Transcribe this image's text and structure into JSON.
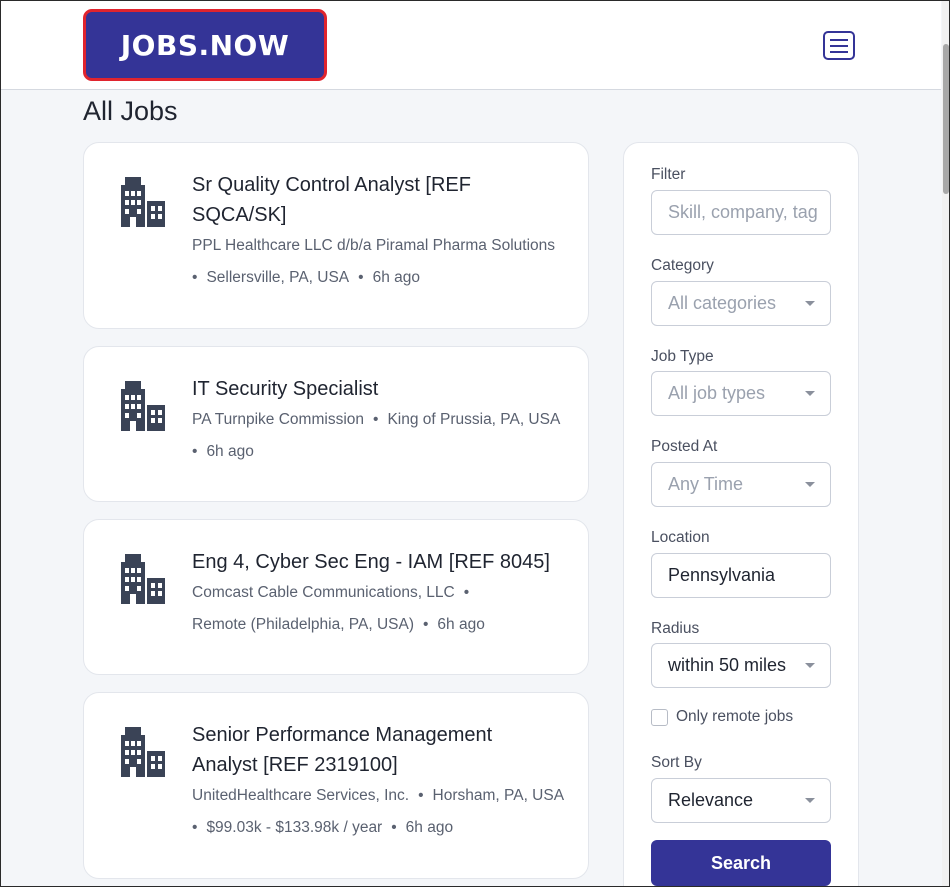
{
  "header": {
    "logo_text": "JOBS.NOW",
    "menu_icon": "hamburger-menu-icon"
  },
  "page": {
    "title": "All Jobs"
  },
  "jobs": [
    {
      "title_line1": "Sr Quality Control Analyst [REF",
      "title_line2": "SQCA/SK]",
      "company": "PPL Healthcare LLC d/b/a Piramal Pharma Solutions",
      "location": "Sellersville, PA, USA",
      "posted": "6h ago",
      "icon": "building-icon"
    },
    {
      "title_line1": "IT Security Specialist",
      "company": "PA Turnpike Commission",
      "location": "King of Prussia, PA, USA",
      "posted": "6h ago",
      "icon": "building-icon"
    },
    {
      "title_line1": "Eng 4, Cyber Sec Eng - IAM [REF 8045]",
      "company": "Comcast Cable Communications, LLC",
      "location": "Remote (Philadelphia, PA, USA)",
      "posted": "6h ago",
      "icon": "building-icon"
    },
    {
      "title_line1": "Senior Performance Management",
      "title_line2": "Analyst [REF 2319100]",
      "company": "UnitedHealthcare Services, Inc.",
      "location": "Horsham, PA, USA",
      "salary": "$99.03k - $133.98k / year",
      "posted": "6h ago",
      "icon": "building-icon"
    }
  ],
  "filters": {
    "filter_label": "Filter",
    "filter_placeholder": "Skill, company, tag",
    "filter_value": "",
    "category_label": "Category",
    "category_value": "All categories",
    "jobtype_label": "Job Type",
    "jobtype_value": "All job types",
    "posted_label": "Posted At",
    "posted_value": "Any Time",
    "location_label": "Location",
    "location_value": "Pennsylvania",
    "radius_label": "Radius",
    "radius_value": "within 50 miles",
    "remote_label": "Only remote jobs",
    "remote_checked": false,
    "sort_label": "Sort By",
    "sort_value": "Relevance",
    "search_label": "Search"
  },
  "colors": {
    "brand": "#343497",
    "logo_border": "#e0242e",
    "page_bg": "#f4f6f9",
    "icon": "#3a4356"
  }
}
